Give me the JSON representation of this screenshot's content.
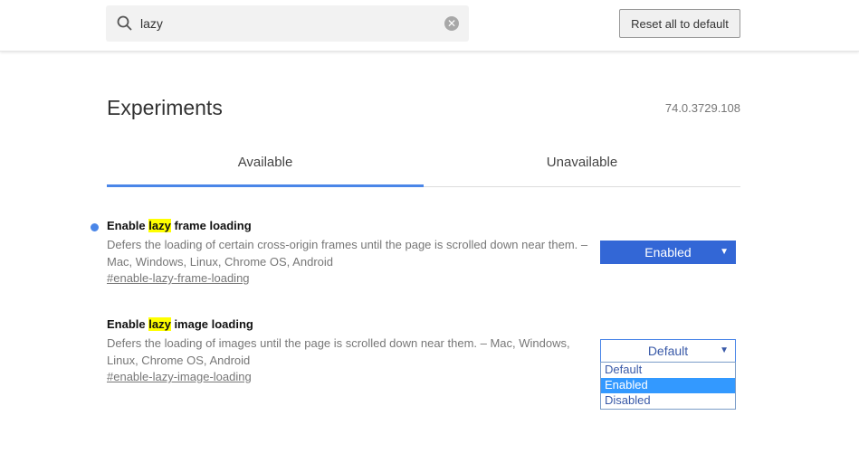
{
  "header": {
    "search_value": "lazy",
    "reset_label": "Reset all to default"
  },
  "page": {
    "title": "Experiments",
    "version": "74.0.3729.108"
  },
  "tabs": [
    {
      "label": "Available"
    },
    {
      "label": "Unavailable"
    }
  ],
  "experiments": [
    {
      "title_pre": "Enable ",
      "title_hl": "lazy",
      "title_post": " frame loading",
      "desc": "Defers the loading of certain cross-origin frames until the page is scrolled down near them. – Mac, Windows, Linux, Chrome OS, Android",
      "link": "#enable-lazy-frame-loading",
      "value": "Enabled"
    },
    {
      "title_pre": "Enable ",
      "title_hl": "lazy",
      "title_post": " image loading",
      "desc": "Defers the loading of images until the page is scrolled down near them. – Mac, Windows, Linux, Chrome OS, Android",
      "link": "#enable-lazy-image-loading",
      "value": "Default",
      "options": [
        "Default",
        "Enabled",
        "Disabled"
      ]
    }
  ],
  "colors": {
    "accent": "#4a86e8",
    "enabled_bg": "#3367d6",
    "highlight": "#ffff00"
  }
}
